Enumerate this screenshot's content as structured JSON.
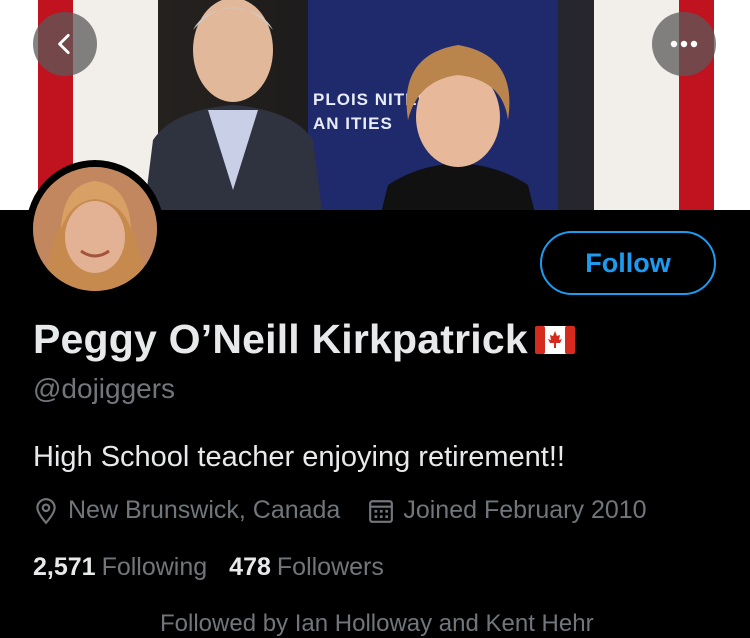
{
  "header": {
    "backdrop_lines": [
      "PLOIS  NITÉS",
      "AN  ITIES"
    ],
    "back_icon": "chevron-left-icon",
    "more_icon": "more-horizontal-icon"
  },
  "profile": {
    "follow_label": "Follow",
    "name": "Peggy O’Neill Kirkpatrick",
    "handle": "@dojiggers",
    "bio": "High School teacher enjoying retirement!!",
    "location": "New Brunswick, Canada",
    "joined": "Joined February 2010",
    "following_count": "2,571",
    "following_label": "Following",
    "followers_count": "478",
    "followers_label": "Followers",
    "followed_by": "Followed by Ian Holloway and Kent Hehr"
  },
  "colors": {
    "accent": "#1d9bf0",
    "background": "#000000",
    "secondary_text": "#71767b",
    "primary_text": "#e7e9ea"
  }
}
